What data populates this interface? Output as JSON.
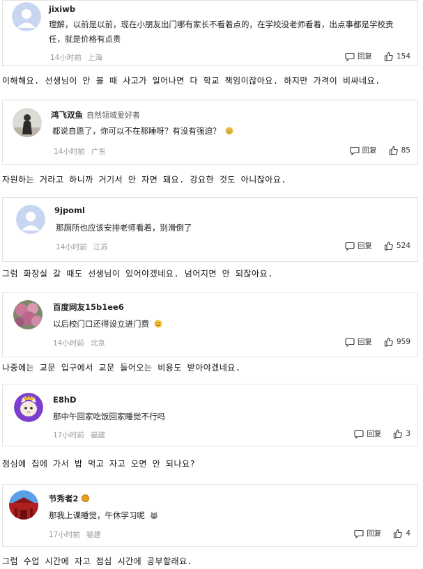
{
  "comments": [
    {
      "username": "jixiwb",
      "tag": "",
      "text": "理解，以前是以前，现在小朋友出门哪有家长不看着点的，在学校没老师看着，出点事都是学校责任，就是价格有点贵",
      "time": "14小时前",
      "location": "上海",
      "reply_label": "回复",
      "likes": "154",
      "translation": "이해해요. 선생님이 안 볼 때 사고가 일어나면 다 학교 책임이잖아요. 하지만 가격이 비싸네요."
    },
    {
      "username": "鸿飞双鱼",
      "tag": "自然领域爱好者",
      "text": "都说自愿了，你可以不在那睡呀？有没有强迫？",
      "time": "14小时前",
      "location": "广东",
      "reply_label": "回复",
      "likes": "85",
      "translation": "자원하는 거라고 하니까 거기서 안 자면 돼요. 강요한 것도 아니잖아요."
    },
    {
      "username": "9jpoml",
      "tag": "",
      "text": "那厕所也应该安排老师看着，别滑倒了",
      "time": "14小时前",
      "location": "江苏",
      "reply_label": "回复",
      "likes": "524",
      "translation": "그럼 화장실 갈 때도 선생님이 있어야겠네요. 넘어지면 안 되잖아요."
    },
    {
      "username": "百度网友15b1ee6",
      "tag": "",
      "text": "以后校门口还得设立进门费",
      "time": "14小时前",
      "location": "北京",
      "reply_label": "回复",
      "likes": "959",
      "translation": "나중에는 교문 입구에서 교문 들어오는 비용도 받아야겠네요."
    },
    {
      "username": "E8hD",
      "tag": "",
      "text": "那中午回家吃饭回家睡觉不行吗",
      "time": "17小时前",
      "location": "福建",
      "reply_label": "回复",
      "likes": "3",
      "translation": "점심에 집에 가서 밥 먹고 자고 오면 안 되나요?"
    },
    {
      "username": "节秀者2",
      "tag": "",
      "text": "那我上课睡觉，午休学习呢",
      "time": "17小时前",
      "location": "福建",
      "reply_label": "回复",
      "likes": "4",
      "translation": "그럼 수업 시간에 자고 점심 시간에 공부할래요."
    }
  ],
  "icons": {
    "reply": "comment-bubble-icon",
    "like": "thumbs-up-icon",
    "emoji_laugh": "laughing-tears-emoji-icon",
    "emoji_smile": "grinning-emoji-icon",
    "emoji_cat": "cat-face-emoji-icon",
    "badge": "medal-badge-icon"
  },
  "colors": {
    "meta_text": "#999999",
    "border": "#e2e2e2",
    "default_avatar": "#c9d6f2"
  }
}
